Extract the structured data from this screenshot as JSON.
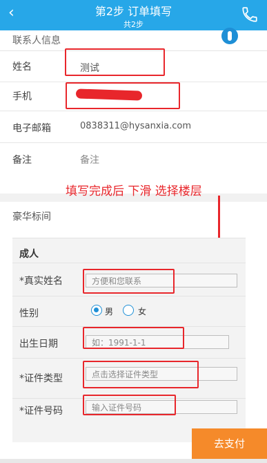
{
  "header": {
    "back_icon": "chevron-left-icon",
    "title": "第2步 订单填写",
    "subtitle": "共2步",
    "phone_icon": "phone-icon",
    "bg_color": "#27a7e8"
  },
  "contact_section": {
    "label": "联系人信息",
    "icon": "contact-book-icon",
    "fields": [
      {
        "label": "姓名",
        "value": "测试"
      },
      {
        "label": "手机",
        "value": ""
      },
      {
        "label": "电子邮箱",
        "value": "0838311@hysanxia.com"
      },
      {
        "label": "备注",
        "placeholder": "备注"
      }
    ]
  },
  "annotation": {
    "text": "填写完成后 下滑 选择楼层",
    "color": "#e8262b"
  },
  "room": {
    "title": "豪华标间",
    "guest_type": "成人",
    "fields": {
      "real_name": {
        "label": "*真实姓名",
        "placeholder": "方便和您联系"
      },
      "gender": {
        "label": "性别",
        "options": [
          "男",
          "女"
        ],
        "selected": "男"
      },
      "birthday": {
        "label": "出生日期",
        "placeholder": "如：1991-1-1"
      },
      "id_type": {
        "label": "*证件类型",
        "placeholder": "点击选择证件类型"
      },
      "id_number": {
        "label": "*证件号码",
        "placeholder": "输入证件号码"
      }
    }
  },
  "footer": {
    "pay_label": "去支付",
    "pay_color": "#f58a2a"
  }
}
